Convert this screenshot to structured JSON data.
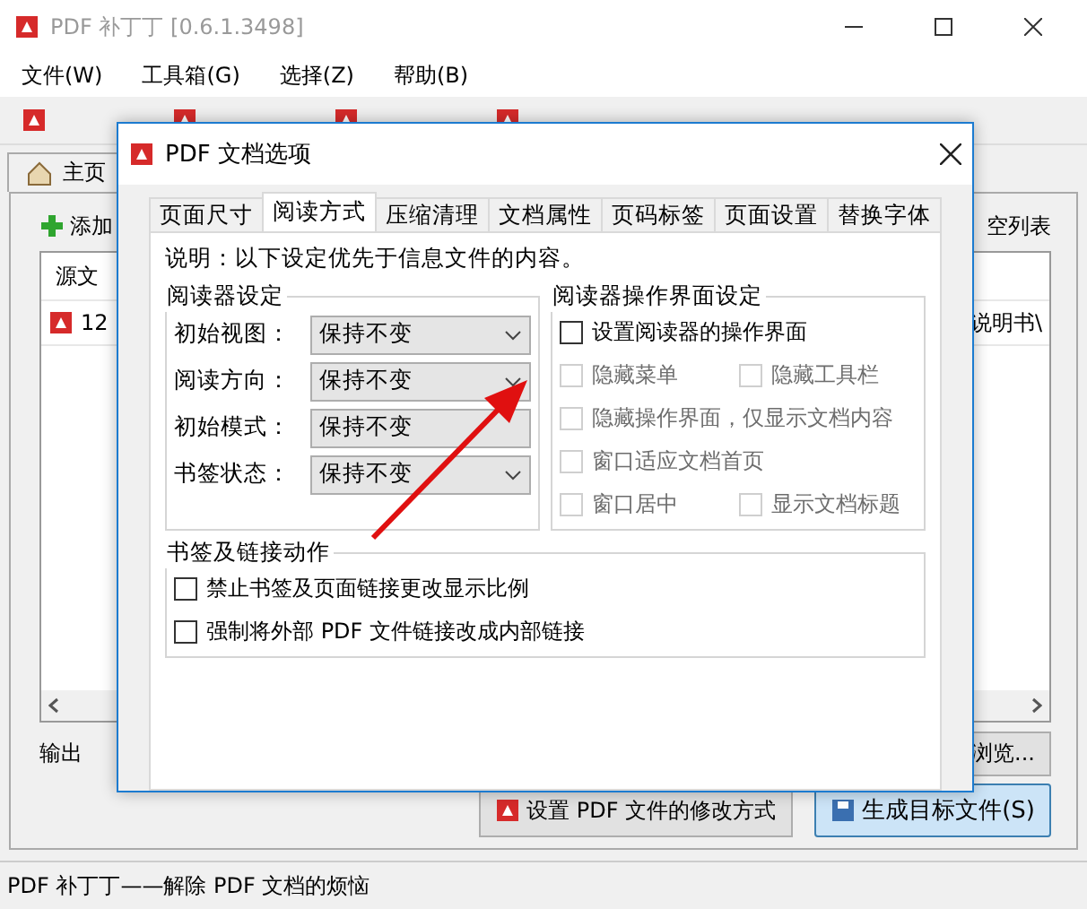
{
  "window": {
    "title": "PDF 补丁丁 [0.6.1.3498]"
  },
  "menu": [
    "文件(W)",
    "工具箱(G)",
    "选择(Z)",
    "帮助(B)"
  ],
  "toolbar": [
    {
      "kind": "pdf"
    },
    {
      "kind": "pdf"
    },
    {
      "kind": "pdf"
    },
    {
      "kind": "pdf"
    }
  ],
  "main_tab": {
    "label": "主页",
    "selected": true
  },
  "add_button": "添加",
  "clear_button": "空列表",
  "file_list": {
    "column_1": "源文",
    "rows": [
      {
        "source": "12",
        "column_2": "说明书\\"
      }
    ]
  },
  "output_label": "输出",
  "browse_button": "浏览...",
  "modify_button": "设置 PDF 文件的修改方式",
  "generate_button": "生成目标文件(S)",
  "status_bar": "PDF 补丁丁——解除 PDF 文档的烦恼",
  "dialog": {
    "title": "PDF 文档选项",
    "tabs": [
      {
        "label": "页面尺寸",
        "selected": false
      },
      {
        "label": "阅读方式",
        "selected": true
      },
      {
        "label": "压缩清理",
        "selected": false
      },
      {
        "label": "文档属性",
        "selected": false
      },
      {
        "label": "页码标签",
        "selected": false
      },
      {
        "label": "页面设置",
        "selected": false
      },
      {
        "label": "替换字体",
        "selected": false
      }
    ],
    "note": "说明：以下设定优先于信息文件的内容。",
    "reader_settings": {
      "title": "阅读器设定",
      "rows": [
        {
          "label": "初始视图：",
          "value": "保持不变",
          "caret": true
        },
        {
          "label": "阅读方向：",
          "value": "保持不变",
          "caret": true
        },
        {
          "label": "初始模式：",
          "value": "保持不变",
          "caret": false
        },
        {
          "label": "书签状态：",
          "value": "保持不变",
          "caret": true
        }
      ]
    },
    "interface_settings": {
      "title": "阅读器操作界面设定",
      "rows": [
        [
          {
            "label": "设置阅读器的操作界面",
            "checked": false,
            "disabled": false
          }
        ],
        [
          {
            "label": "隐藏菜单",
            "checked": false,
            "disabled": true
          },
          {
            "label": "隐藏工具栏",
            "checked": false,
            "disabled": true
          }
        ],
        [
          {
            "label": "隐藏操作界面，仅显示文档内容",
            "checked": false,
            "disabled": true
          }
        ],
        [
          {
            "label": "窗口适应文档首页",
            "checked": false,
            "disabled": true
          }
        ],
        [
          {
            "label": "窗口居中",
            "checked": false,
            "disabled": true
          },
          {
            "label": "显示文档标题",
            "checked": false,
            "disabled": true
          }
        ]
      ]
    },
    "link_actions": {
      "title": "书签及链接动作",
      "items": [
        {
          "label": "禁止书签及页面链接更改显示比例",
          "checked": false,
          "disabled": false
        },
        {
          "label": "强制将外部 PDF 文件链接改成内部链接",
          "checked": false,
          "disabled": false
        }
      ]
    }
  }
}
